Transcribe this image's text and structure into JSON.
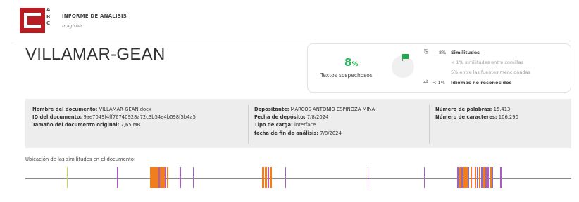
{
  "header": {
    "logo_letters": [
      "A",
      "B",
      "C"
    ],
    "title": "INFORME DE ANÁLISIS",
    "subtitle": "magister"
  },
  "document_title": "VILLAMAR-GEAN",
  "similarity": {
    "percent_value": "8",
    "percent_symbol": "%",
    "label": "Textos sospechosos",
    "rows": [
      {
        "icon": "copy-icon",
        "value": "8%",
        "text": "Similitudes",
        "style": "strong"
      },
      {
        "icon": "",
        "value": "",
        "text": "< 1% similitudes entre comillas",
        "style": "light"
      },
      {
        "icon": "",
        "value": "",
        "text": "5% entre las fuentes mencionadas",
        "style": "light"
      },
      {
        "icon": "translate-icon",
        "value": "< 1%",
        "text": "Idiomas no reconocidos",
        "style": "strong"
      }
    ],
    "accent_color": "#2fb55b"
  },
  "info": {
    "col1": [
      {
        "label": "Nombre del documento:",
        "value": "VILLAMAR-GEAN.docx"
      },
      {
        "label": "ID del documento:",
        "value": "9ae7049f4ff76740928a72c3b54e4b098f5b4a5"
      },
      {
        "label": "Tamaño del documento original:",
        "value": "2,65 MB"
      }
    ],
    "col2": [
      {
        "label": "Depositante:",
        "value": "MARCOS ANTONIO ESPINOZA MINA"
      },
      {
        "label": "Fecha de depósito:",
        "value": "7/8/2024"
      },
      {
        "label": "Tipo de carga:",
        "value": "interface"
      },
      {
        "label": "fecha de fin de análisis:",
        "value": "7/8/2024"
      }
    ],
    "col3": [
      {
        "label": "Número de palabras:",
        "value": "15.413"
      },
      {
        "label": "Número de caracteres:",
        "value": "106.290"
      }
    ]
  },
  "location": {
    "label": "Ubicación de las similitudes en el documento:",
    "colors": {
      "purple": "#a85cc8",
      "orange": "#f07d1e",
      "lime": "#c9d84a"
    },
    "marks": [
      {
        "pos": 0.076,
        "color": "lime"
      },
      {
        "pos": 0.168,
        "color": "purple"
      },
      {
        "pos": 0.229,
        "color": "orange"
      },
      {
        "pos": 0.232,
        "color": "orange"
      },
      {
        "pos": 0.235,
        "color": "orange"
      },
      {
        "pos": 0.238,
        "color": "orange"
      },
      {
        "pos": 0.241,
        "color": "orange"
      },
      {
        "pos": 0.244,
        "color": "purple"
      },
      {
        "pos": 0.247,
        "color": "orange"
      },
      {
        "pos": 0.25,
        "color": "orange"
      },
      {
        "pos": 0.253,
        "color": "orange"
      },
      {
        "pos": 0.256,
        "color": "purple"
      },
      {
        "pos": 0.259,
        "color": "orange"
      },
      {
        "pos": 0.283,
        "color": "purple"
      },
      {
        "pos": 0.307,
        "color": "purple"
      },
      {
        "pos": 0.434,
        "color": "orange"
      },
      {
        "pos": 0.439,
        "color": "orange"
      },
      {
        "pos": 0.444,
        "color": "purple"
      },
      {
        "pos": 0.448,
        "color": "orange"
      },
      {
        "pos": 0.476,
        "color": "purple"
      },
      {
        "pos": 0.627,
        "color": "purple"
      },
      {
        "pos": 0.73,
        "color": "purple"
      },
      {
        "pos": 0.791,
        "color": "purple"
      },
      {
        "pos": 0.795,
        "color": "orange"
      },
      {
        "pos": 0.799,
        "color": "purple"
      },
      {
        "pos": 0.803,
        "color": "orange"
      },
      {
        "pos": 0.807,
        "color": "orange"
      },
      {
        "pos": 0.811,
        "color": "purple"
      },
      {
        "pos": 0.815,
        "color": "orange"
      },
      {
        "pos": 0.819,
        "color": "purple"
      },
      {
        "pos": 0.823,
        "color": "orange"
      },
      {
        "pos": 0.827,
        "color": "purple"
      },
      {
        "pos": 0.831,
        "color": "orange"
      },
      {
        "pos": 0.835,
        "color": "purple"
      },
      {
        "pos": 0.839,
        "color": "orange"
      },
      {
        "pos": 0.843,
        "color": "purple"
      },
      {
        "pos": 0.847,
        "color": "purple"
      },
      {
        "pos": 0.851,
        "color": "orange"
      },
      {
        "pos": 0.855,
        "color": "purple"
      },
      {
        "pos": 0.87,
        "color": "purple"
      }
    ]
  }
}
